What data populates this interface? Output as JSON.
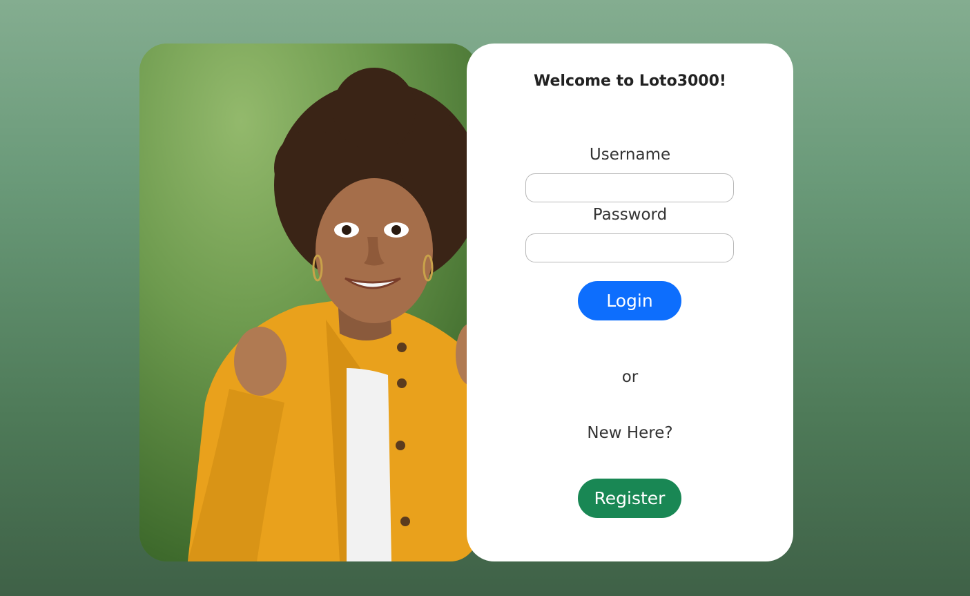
{
  "photo": {
    "alt": "Excited woman in yellow jacket"
  },
  "login": {
    "title": "Welcome to Loto3000!",
    "username_label": "Username",
    "username_value": "",
    "password_label": "Password",
    "password_value": "",
    "login_button": "Login",
    "or_text": "or",
    "new_here_text": "New Here?",
    "register_button": "Register"
  },
  "colors": {
    "login_button": "#0d6efd",
    "register_button": "#198754",
    "background_top": "#84ad90",
    "background_bottom": "#3f6147"
  }
}
